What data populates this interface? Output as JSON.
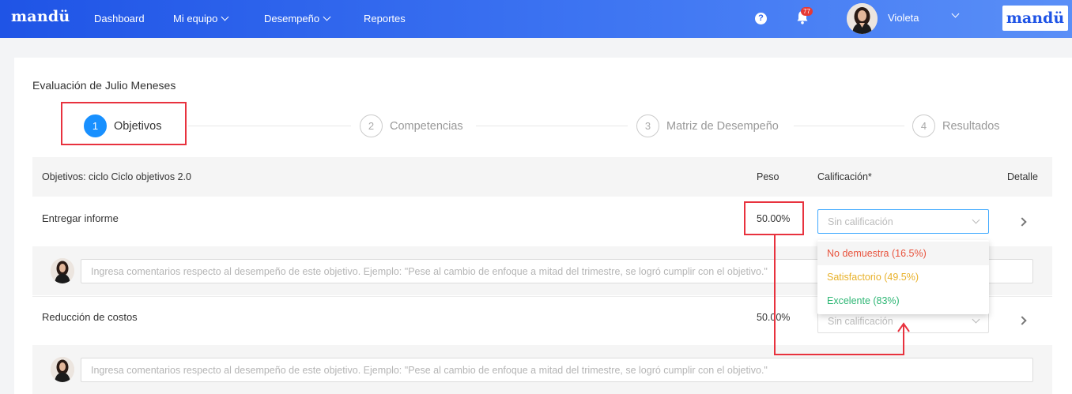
{
  "nav": {
    "brand": "mandü",
    "items": [
      {
        "label": "Dashboard"
      },
      {
        "label": "Mi equipo"
      },
      {
        "label": "Desempeño"
      },
      {
        "label": "Reportes"
      }
    ],
    "help_glyph": "?",
    "notification_count": "77",
    "user_name": "Violeta",
    "brand_logo": "mandü"
  },
  "page": {
    "title": "Evaluación de Julio Meneses"
  },
  "stepper": [
    {
      "number": "1",
      "label": "Objetivos",
      "active": true
    },
    {
      "number": "2",
      "label": "Competencias",
      "active": false
    },
    {
      "number": "3",
      "label": "Matriz de Desempeño",
      "active": false
    },
    {
      "number": "4",
      "label": "Resultados",
      "active": false
    }
  ],
  "table": {
    "headers": {
      "objective": "Objetivos: ciclo Ciclo objetivos 2.0",
      "weight": "Peso",
      "rating": "Calificación*",
      "detail": "Detalle"
    },
    "rows": [
      {
        "name": "Entregar informe",
        "weight": "50.00%",
        "rating_placeholder": "Sin calificación",
        "comment_placeholder": "Ingresa comentarios respecto al desempeño de este objetivo. Ejemplo: \"Pese al cambio de enfoque a mitad del trimestre, se logró cumplir con el objetivo.\""
      },
      {
        "name": "Reducción de costos",
        "weight": "50.00%",
        "rating_placeholder": "Sin calificación",
        "comment_placeholder": "Ingresa comentarios respecto al desempeño de este objetivo. Ejemplo: \"Pese al cambio de enfoque a mitad del trimestre, se logró cumplir con el objetivo.\""
      }
    ]
  },
  "dropdown": {
    "options": [
      {
        "label": "No demuestra (16.5%)",
        "color": "#e8533d"
      },
      {
        "label": "Satisfactorio (49.5%)",
        "color": "#e8b12a"
      },
      {
        "label": "Excelente (83%)",
        "color": "#2db674"
      }
    ]
  },
  "colors": {
    "primary": "#1890ff",
    "annotation": "#e8323e",
    "nav_start": "#1f54e6",
    "nav_end": "#5a8ff7"
  }
}
